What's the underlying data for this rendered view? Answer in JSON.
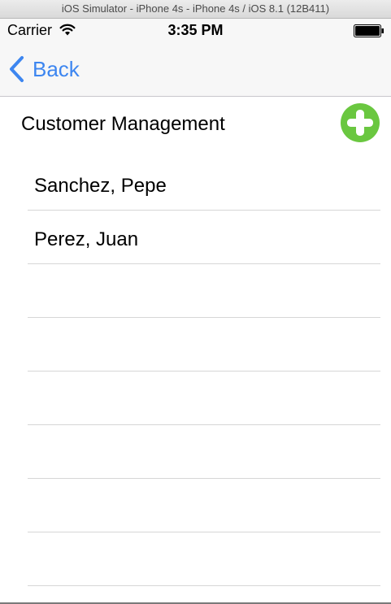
{
  "simulator": {
    "title": "iOS Simulator - iPhone 4s - iPhone 4s / iOS 8.1 (12B411)"
  },
  "status_bar": {
    "carrier": "Carrier",
    "time": "3:35 PM",
    "wifi_icon": "wifi-icon",
    "battery_icon": "battery-icon"
  },
  "nav_bar": {
    "back_label": "Back",
    "back_icon": "chevron-left-icon",
    "accent_color": "#3d86f0"
  },
  "header": {
    "title": "Customer Management",
    "add_icon": "add-circle-icon",
    "add_icon_color": "#6ac740"
  },
  "customers": [
    {
      "name": "Sanchez, Pepe"
    },
    {
      "name": "Perez, Juan"
    },
    {
      "name": ""
    },
    {
      "name": ""
    },
    {
      "name": ""
    },
    {
      "name": ""
    },
    {
      "name": ""
    },
    {
      "name": ""
    }
  ]
}
